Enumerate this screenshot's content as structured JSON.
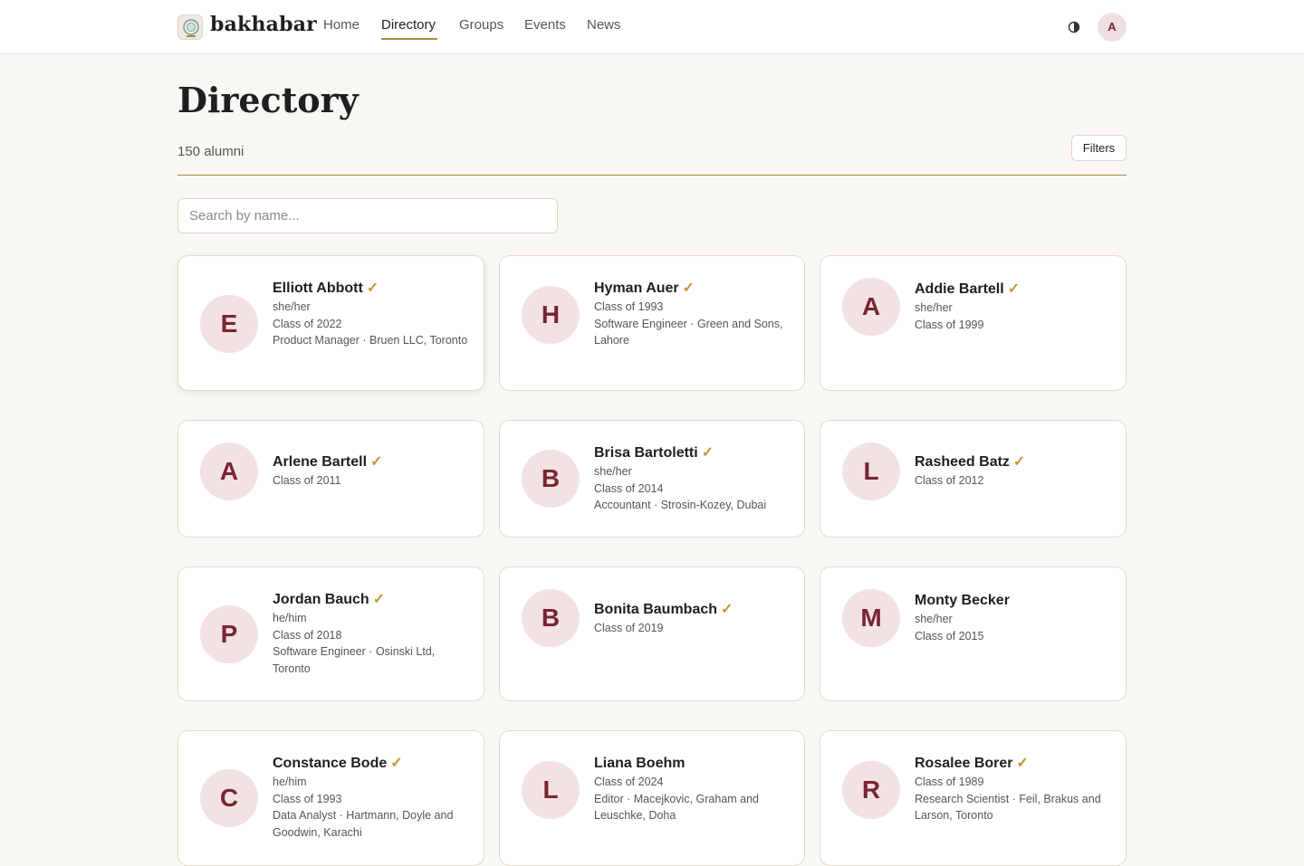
{
  "app": {
    "brand": "bakhabar"
  },
  "nav": {
    "home": "Home",
    "directory": "Directory",
    "groups": "Groups",
    "events": "Events",
    "news": "News",
    "theme_icon": "contrast-icon",
    "user_initial": "A"
  },
  "page": {
    "title": "Directory",
    "count": "150 alumni",
    "filters_label": "Filters",
    "search_placeholder": "Search by name..."
  },
  "colors": {
    "accent_gold": "#b08a3e",
    "verified_check": "#c8962e",
    "avatar_bg": "#f2e2e4",
    "avatar_text": "#7a2530",
    "background": "#f8f7f4"
  },
  "alumni": [
    {
      "initial": "E",
      "name": "Elliott Abbott",
      "verified": "✓",
      "pronouns": "she/her",
      "class": "Class of 2022",
      "role": "Product Manager · Bruen LLC, Toronto"
    },
    {
      "initial": "H",
      "name": "Hyman Auer",
      "verified": "✓",
      "class": "Class of 1993",
      "role": "Software Engineer · Green and Sons, Lahore"
    },
    {
      "initial": "A",
      "name": "Addie Bartell",
      "verified": "✓",
      "pronouns": "she/her",
      "class": "Class of 1999"
    },
    {
      "initial": "A",
      "name": "Arlene Bartell",
      "verified": "✓",
      "class": "Class of 2011"
    },
    {
      "initial": "B",
      "name": "Brisa Bartoletti",
      "verified": "✓",
      "pronouns": "she/her",
      "class": "Class of 2014",
      "role": "Accountant · Strosin-Kozey, Dubai"
    },
    {
      "initial": "L",
      "name": "Rasheed Batz",
      "verified": "✓",
      "class": "Class of 2012"
    },
    {
      "initial": "P",
      "name": "Jordan Bauch",
      "verified": "✓",
      "pronouns": "he/him",
      "class": "Class of 2018",
      "role": "Software Engineer · Osinski Ltd, Toronto"
    },
    {
      "initial": "B",
      "name": "Bonita Baumbach",
      "verified": "✓",
      "class": "Class of 2019"
    },
    {
      "initial": "M",
      "name": "Monty Becker",
      "pronouns": "she/her",
      "class": "Class of 2015"
    },
    {
      "initial": "C",
      "name": "Constance Bode",
      "verified": "✓",
      "pronouns": "he/him",
      "class": "Class of 1993",
      "role": "Data Analyst · Hartmann, Doyle and Goodwin, Karachi"
    },
    {
      "initial": "L",
      "name": "Liana Boehm",
      "class": "Class of 2024",
      "role": "Editor · Macejkovic, Graham and Leuschke, Doha"
    },
    {
      "initial": "R",
      "name": "Rosalee Borer",
      "verified": "✓",
      "class": "Class of 1989",
      "role": "Research Scientist · Feil, Brakus and Larson, Toronto"
    }
  ]
}
